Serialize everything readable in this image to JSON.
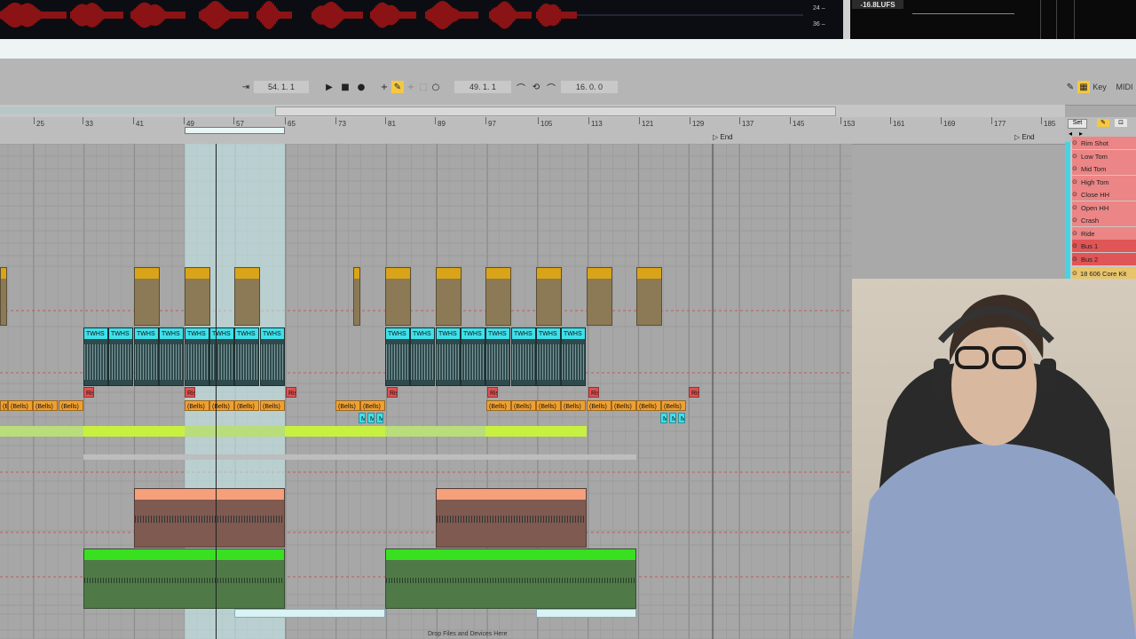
{
  "meter": {
    "db_24": "24 –",
    "db_36": "36 –",
    "lufs": "-16.8LUFS"
  },
  "transport": {
    "arrangement_position": "54.  1.  1",
    "loop_start": "49.  1.  1",
    "loop_length": "16.  0.  0",
    "key_label": "Key",
    "midi_label": "MIDI"
  },
  "ruler": {
    "bars": [
      "25",
      "33",
      "41",
      "49",
      "57",
      "65",
      "73",
      "81",
      "89",
      "97",
      "105",
      "113",
      "121",
      "129",
      "137",
      "145",
      "153",
      "161",
      "169",
      "177",
      "185"
    ],
    "end_label_1": "End",
    "end_label_2": "End",
    "set_label": "Set"
  },
  "tracks": [
    "Rim Shot",
    "Low Tom",
    "Mid Tom",
    "High Tom",
    "Close HH",
    "Open HH",
    "Crash",
    "Ride",
    "Bus 1",
    "Bus 2"
  ],
  "group_track": "18 606 Core Kit",
  "clips": {
    "twhs": "TWHS",
    "bells": "(Bells)",
    "ris": "Ris",
    "m": "M"
  },
  "drop_hint": "Drop Files and Devices Here",
  "colors": {
    "yellow": "#d9a418",
    "cyan": "#3fe0ea",
    "orange": "#f0a030",
    "red": "#e05050",
    "lime": "#c8f040",
    "salmon": "#f5a07a",
    "green": "#39e020",
    "loop": "#b8e6ea"
  }
}
